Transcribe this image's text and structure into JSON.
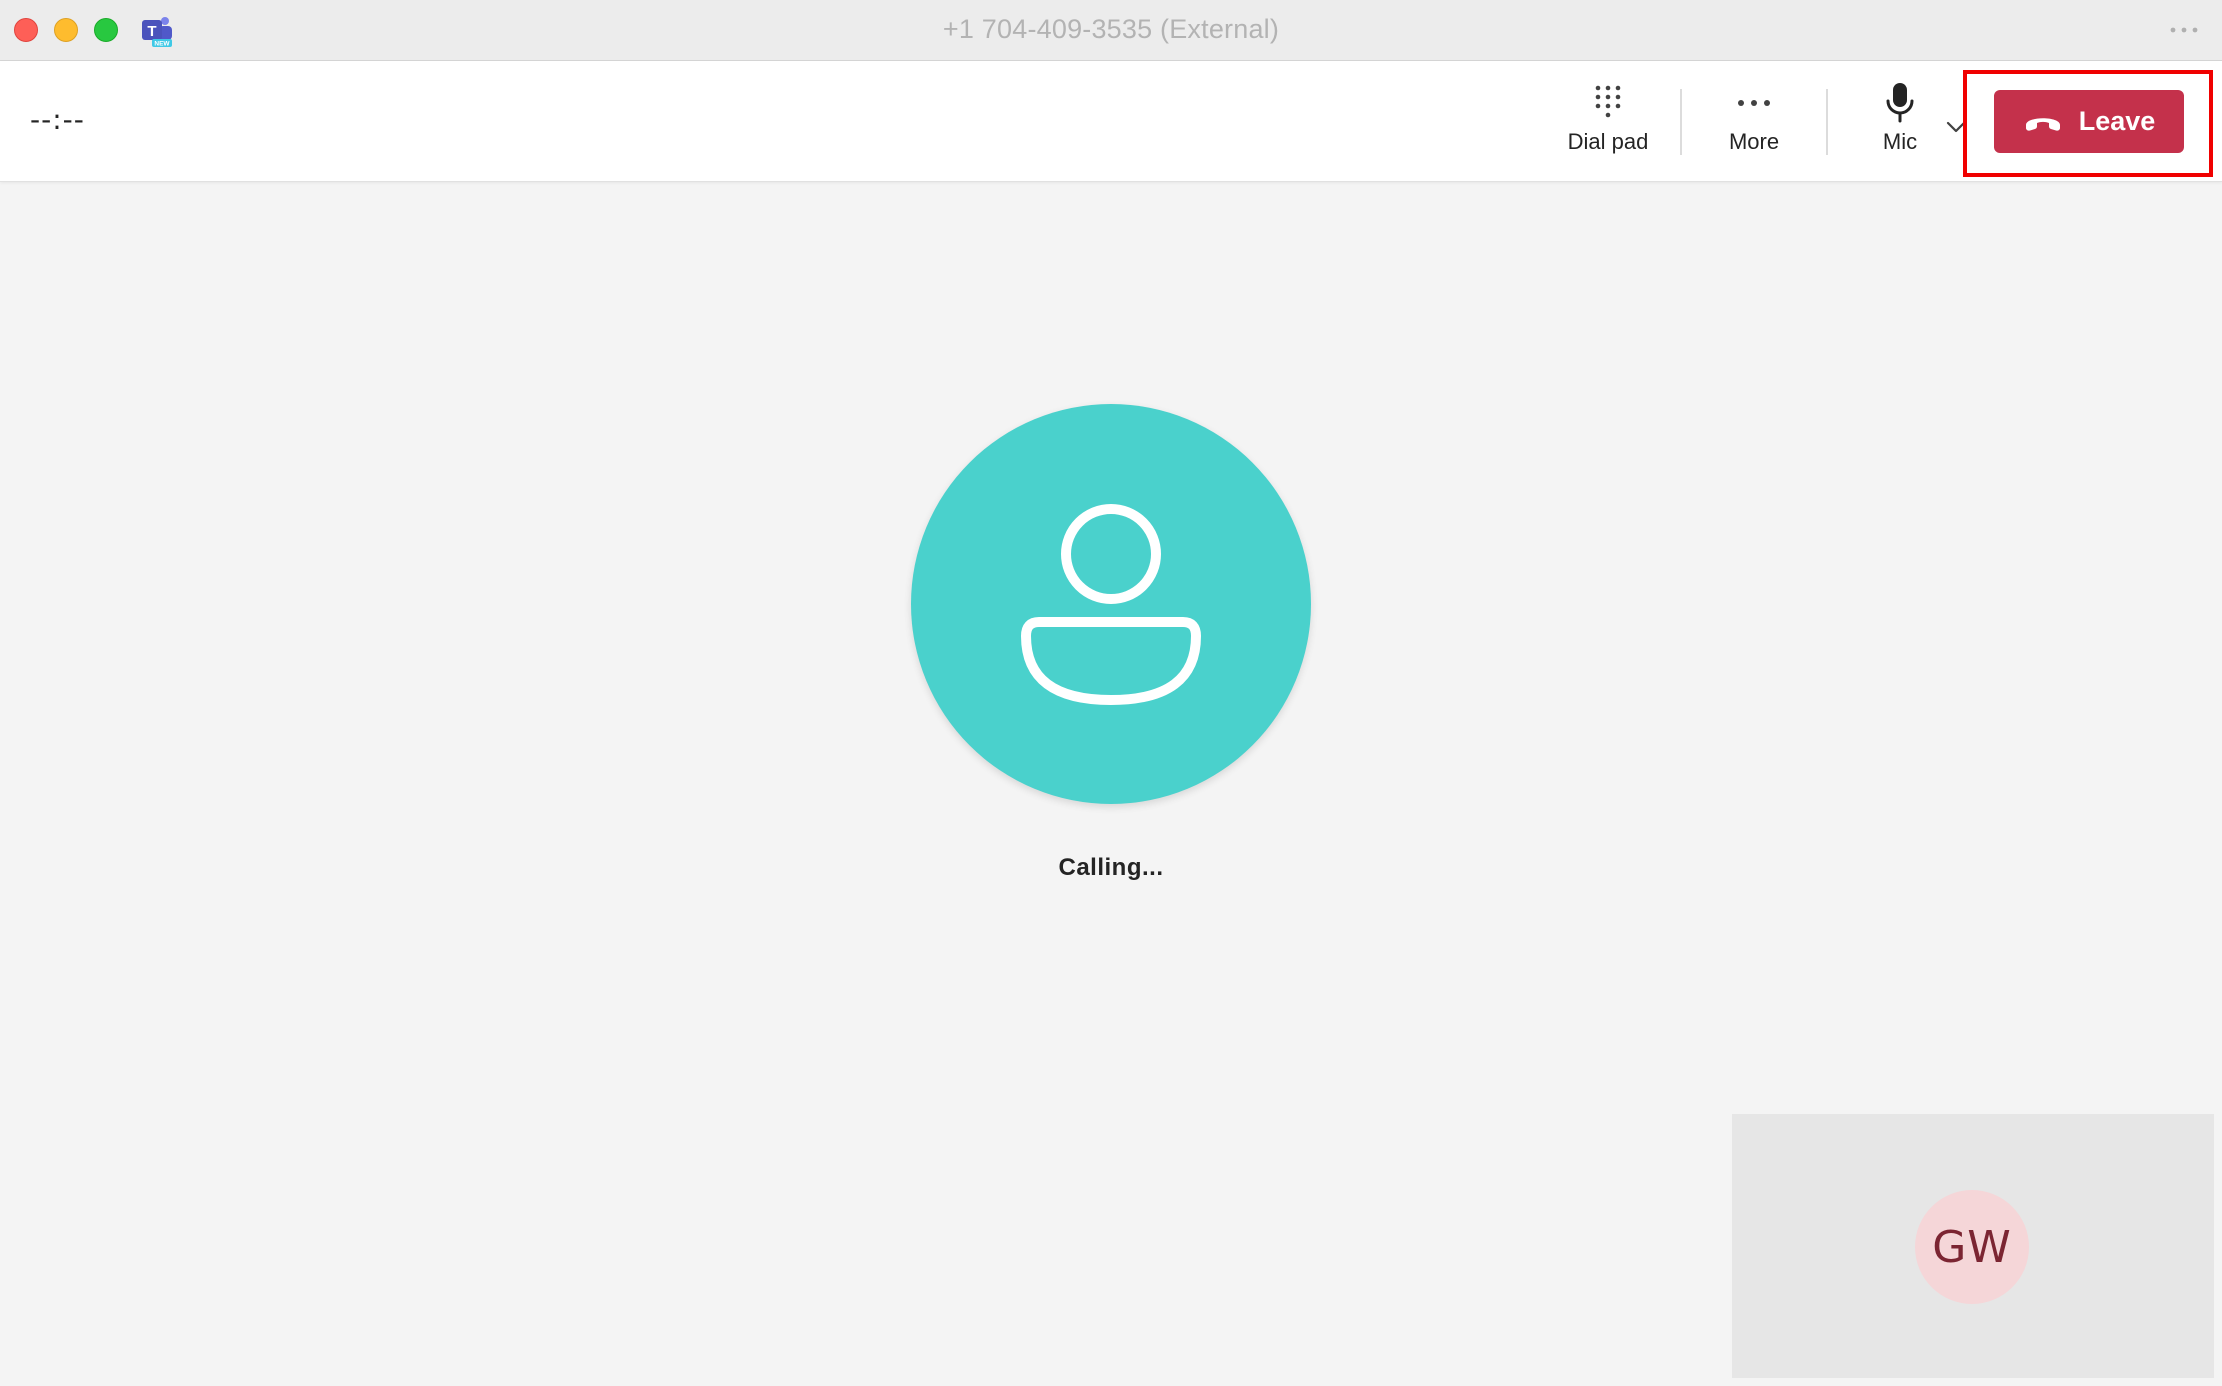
{
  "window": {
    "title": "+1 704-409-3535 (External)",
    "app_icon": "teams-icon",
    "app_icon_badge": "NEW"
  },
  "toolbar": {
    "timer": "--:--",
    "dialpad_label": "Dial pad",
    "more_label": "More",
    "mic_label": "Mic",
    "leave_label": "Leave"
  },
  "stage": {
    "status": "Calling..."
  },
  "self_view": {
    "initials": "GW"
  },
  "colors": {
    "leave_button": "#c4314b",
    "avatar_bg": "#4ad1cc",
    "self_avatar_bg": "#f5d6d8",
    "highlight": "#f00000"
  },
  "icons": [
    "close-window-icon",
    "minimize-window-icon",
    "maximize-window-icon",
    "teams-icon",
    "ellipsis-icon",
    "dialpad-icon",
    "more-icon",
    "mic-icon",
    "chevron-down-icon",
    "phone-hangup-icon",
    "person-icon"
  ]
}
